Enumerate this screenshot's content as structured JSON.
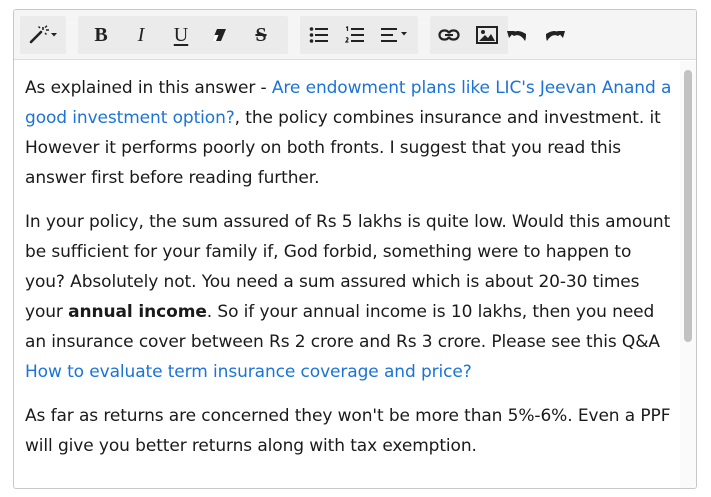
{
  "toolbar": {
    "buttons": [
      {
        "name": "magic-wand",
        "icon": "magic-wand-dropdown-icon"
      },
      {
        "name": "bold",
        "icon": "bold-icon",
        "glyph": "B"
      },
      {
        "name": "italic",
        "icon": "italic-icon",
        "glyph": "I"
      },
      {
        "name": "underline",
        "icon": "underline-icon",
        "glyph": "U"
      },
      {
        "name": "clear-format",
        "icon": "eraser-icon"
      },
      {
        "name": "strikethrough",
        "icon": "strikethrough-icon",
        "glyph": "S"
      },
      {
        "name": "bullet-list",
        "icon": "bulleted-list-icon"
      },
      {
        "name": "numbered-list",
        "icon": "numbered-list-icon"
      },
      {
        "name": "align",
        "icon": "align-dropdown-icon"
      },
      {
        "name": "link",
        "icon": "link-icon"
      },
      {
        "name": "image",
        "icon": "image-icon"
      },
      {
        "name": "undo",
        "icon": "undo-icon"
      },
      {
        "name": "redo",
        "icon": "redo-icon"
      }
    ]
  },
  "content": {
    "p1": {
      "intro": "As explained in this answer - ",
      "link": "Are endowment plans like LIC's Jeevan Anand a good investment option?",
      "rest": ", the policy combines insurance and investment. it However it performs poorly on both fronts. I suggest that you read this answer first before reading further."
    },
    "p2": {
      "text1": "In your policy, the sum assured of Rs 5 lakhs is quite low. Would this amount be sufficient for your family if, God forbid, something were to happen to you? Absolutely not. You need a sum assured which is about 20-30 times your ",
      "bold": "annual income",
      "text2": ". So if your annual income is 10 lakhs, then you need an insurance cover between Rs 2 crore and Rs 3 crore. Please see this Q&A ",
      "link": "How to evaluate term insurance coverage and price?"
    },
    "p3": {
      "text": "As far as returns are concerned they won't be more than 5%-6%. Even a PPF will give you better returns along with tax exemption."
    }
  },
  "colors": {
    "link": "#1a73d9",
    "text": "#1a1a1a",
    "toolbar_bg": "#f5f5f5",
    "button_group_bg": "#ebebeb"
  }
}
